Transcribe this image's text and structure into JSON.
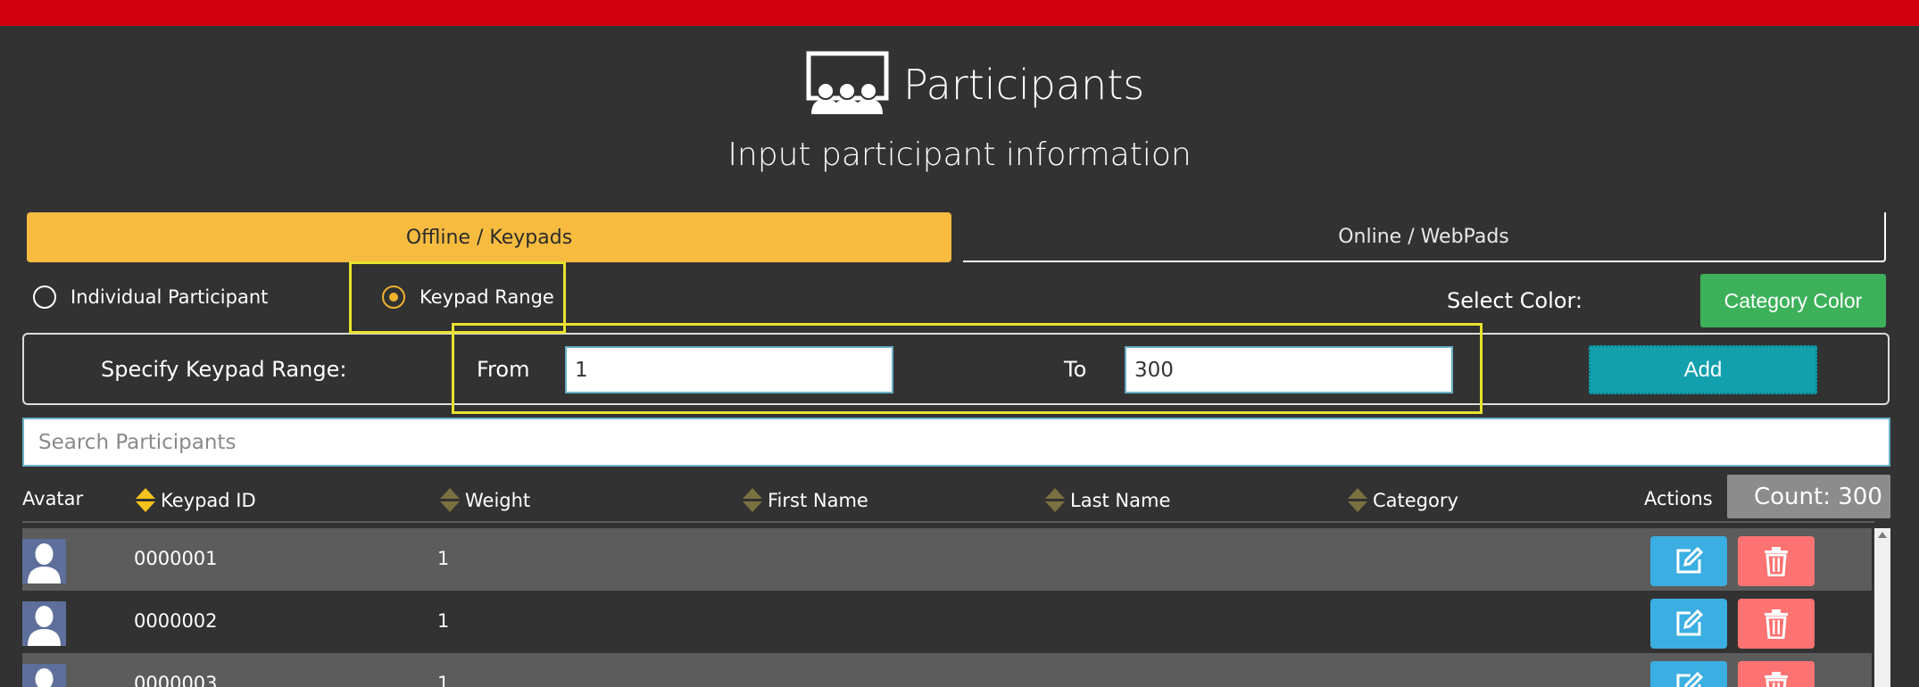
{
  "header": {
    "title": "Participants",
    "subtitle": "Input participant information",
    "icon": "audience-icon"
  },
  "tabs": [
    {
      "label": "Offline / Keypads",
      "active": true
    },
    {
      "label": "Online / WebPads",
      "active": false
    }
  ],
  "mode": {
    "options": [
      {
        "label": "Individual Participant",
        "selected": false
      },
      {
        "label": "Keypad Range",
        "selected": true
      }
    ]
  },
  "color": {
    "label": "Select Color:",
    "button": "Category Color"
  },
  "range": {
    "label": "Specify Keypad Range:",
    "from_label": "From",
    "from_value": "1",
    "to_label": "To",
    "to_value": "300",
    "add_button": "Add"
  },
  "search": {
    "placeholder": "Search Participants"
  },
  "table": {
    "columns": [
      "Avatar",
      "Keypad ID",
      "Weight",
      "First Name",
      "Last Name",
      "Category",
      "Actions"
    ],
    "count_label": "Count: 300",
    "rows": [
      {
        "keypad_id": "0000001",
        "weight": "1"
      },
      {
        "keypad_id": "0000002",
        "weight": "1"
      },
      {
        "keypad_id": "0000003",
        "weight": "1"
      }
    ]
  },
  "colors": {
    "top_bar": "#d0000f",
    "active_tab": "#f6bb3f",
    "radio_selected": "#f0b12e",
    "category_button": "#3cb15a",
    "add_button": "#12a0ad",
    "edit_button": "#3baee2",
    "delete_button": "#fd7272",
    "highlight": "#e9e22f"
  },
  "icons": {
    "sort": "sort-arrows-icon",
    "edit": "edit-icon",
    "delete": "trash-icon",
    "avatar": "user-silhouette-icon"
  }
}
